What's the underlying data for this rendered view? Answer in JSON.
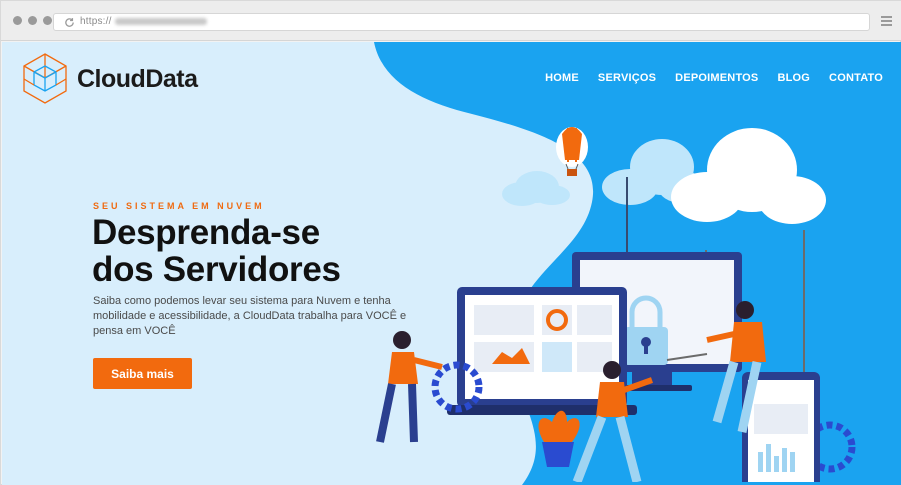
{
  "browser": {
    "url_prefix": "https://",
    "url_blurred": "www.seudominio.com.br"
  },
  "header": {
    "logo_text": "CloudData",
    "nav": [
      {
        "label": "HOME"
      },
      {
        "label": "SERVIÇOS"
      },
      {
        "label": "DEPOIMENTOS"
      },
      {
        "label": "BLOG"
      },
      {
        "label": "CONTATO"
      }
    ]
  },
  "hero": {
    "eyebrow": "SEU SISTEMA EM NUVEM",
    "headline_line1": "Desprenda-se",
    "headline_line2": "dos Servidores",
    "description": "Saiba como podemos levar seu sistema para Nuvem e tenha mobilidade e acessibilidade, a CloudData trabalha para VOCÊ e pensa em VOCÊ",
    "cta_label": "Saiba mais"
  },
  "colors": {
    "accent": "#f26a0e",
    "blue": "#1aa3f0",
    "light_bg": "#d8eefc",
    "text_dark": "#111111"
  },
  "icons": [
    "reload-icon",
    "hamburger-menu-icon",
    "logo-cube-icon"
  ]
}
